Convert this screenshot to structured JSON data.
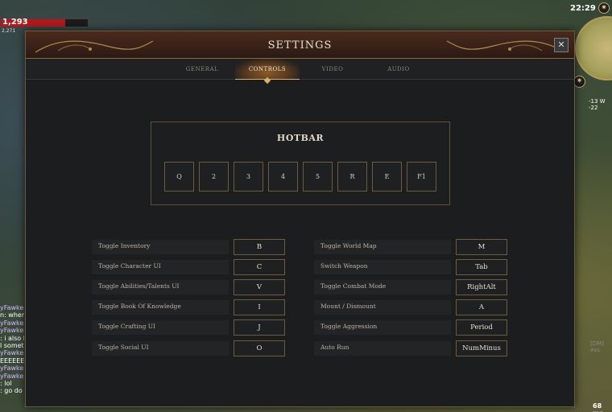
{
  "hud": {
    "health_value": "1,293",
    "health_sub": "2,271",
    "time": "22:29",
    "coords": "-13 W -22",
    "ping": "68 ms",
    "side_note": "[DM] Ass",
    "chat_lines": [
      {
        "text": "yFawkes",
        "player": true
      },
      {
        "text": "n: where",
        "player": false
      },
      {
        "text": "yFawkes",
        "player": true
      },
      {
        "text": "yFawkes",
        "player": true
      },
      {
        "text": ": i also h",
        "player": false
      },
      {
        "text": "l someth",
        "player": false
      },
      {
        "text": "yFawkes",
        "player": true
      },
      {
        "text": "EEEEEEE",
        "player": false
      },
      {
        "text": "yFawkes",
        "player": true
      },
      {
        "text": "yFawkes",
        "player": true
      },
      {
        "text": ": lol",
        "player": false
      },
      {
        "text": ": go do s",
        "player": false
      }
    ]
  },
  "settings": {
    "title": "SETTINGS",
    "close_label": "✕",
    "tabs": [
      {
        "label": "GENERAL",
        "active": false
      },
      {
        "label": "CONTROLS",
        "active": true
      },
      {
        "label": "VIDEO",
        "active": false
      },
      {
        "label": "AUDIO",
        "active": false
      }
    ],
    "hotbar": {
      "title": "HOTBAR",
      "keys": [
        "Q",
        "2",
        "3",
        "4",
        "5",
        "R",
        "E",
        "F1"
      ]
    },
    "bindings_left": [
      {
        "action": "Toggle Inventory",
        "key": "B"
      },
      {
        "action": "Toggle Character UI",
        "key": "C"
      },
      {
        "action": "Toggle Abilities/Talents UI",
        "key": "V"
      },
      {
        "action": "Toggle Book Of Knowledge",
        "key": "I"
      },
      {
        "action": "Toggle Crafting UI",
        "key": "J"
      },
      {
        "action": "Toggle Social UI",
        "key": "O"
      }
    ],
    "bindings_right": [
      {
        "action": "Toggle World Map",
        "key": "M"
      },
      {
        "action": "Switch Weapon",
        "key": "Tab"
      },
      {
        "action": "Toggle Combat Mode",
        "key": "RightAlt"
      },
      {
        "action": "Mount / Dismount",
        "key": "A"
      },
      {
        "action": "Toggle Aggression",
        "key": "Period"
      },
      {
        "action": "Auto Run",
        "key": "NumMinus"
      }
    ]
  },
  "colors": {
    "accent": "#d8b070",
    "titlebar": "#3a2218",
    "panel": "#1b1d1e",
    "health": "#b3181c"
  }
}
